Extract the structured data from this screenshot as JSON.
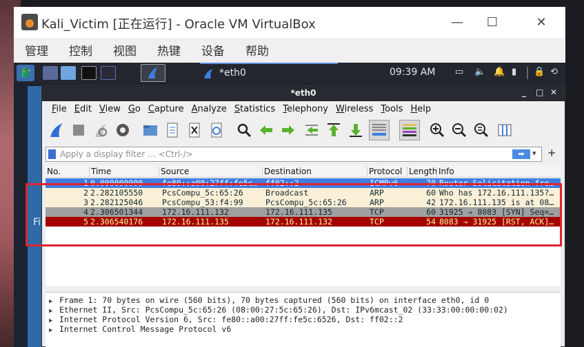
{
  "vbox": {
    "title": "Kali_Victim [正在运行] - Oracle VM VirtualBox",
    "minimize": "—",
    "maximize": "☐",
    "close": "✕",
    "menu": [
      "管理",
      "控制",
      "视图",
      "热键",
      "设备",
      "帮助"
    ]
  },
  "kali_panel": {
    "task_title": "*eth0",
    "clock": "09:39 AM"
  },
  "left_strip_text": "Fi",
  "wireshark": {
    "title": "*eth0",
    "win_min": "_",
    "win_max": "□",
    "win_close": "✕",
    "menu": [
      "File",
      "Edit",
      "View",
      "Go",
      "Capture",
      "Analyze",
      "Statistics",
      "Telephony",
      "Wireless",
      "Tools",
      "Help"
    ],
    "filter_placeholder": "Apply a display filter … <Ctrl-/>",
    "filter_plus": "+",
    "columns": [
      "No.",
      "Time",
      "Source",
      "Destination",
      "Protocol",
      "Length",
      "Info"
    ],
    "packets": [
      {
        "no": "1",
        "time": "0.000000000",
        "source": "fe80::a00:27ff:fe5c…",
        "destination": "ff02::2",
        "protocol": "ICMPv6",
        "length": "70",
        "info": "Router Solicitation fro…",
        "bg": "#3d7de0",
        "fg": "#ffffff"
      },
      {
        "no": "2",
        "time": "2.282105550",
        "source": "PcsCompu_5c:65:26",
        "destination": "Broadcast",
        "protocol": "ARP",
        "length": "60",
        "info": "Who has 172.16.111.135?…",
        "bg": "#faf0d7",
        "fg": "#12272e"
      },
      {
        "no": "3",
        "time": "2.282125046",
        "source": "PcsCompu_53:f4:99",
        "destination": "PcsCompu_5c:65:26",
        "protocol": "ARP",
        "length": "42",
        "info": "172.16.111.135 is at 08…",
        "bg": "#faf0d7",
        "fg": "#12272e"
      },
      {
        "no": "4",
        "time": "2.306501344",
        "source": "172.16.111.132",
        "destination": "172.16.111.135",
        "protocol": "TCP",
        "length": "60",
        "info": "31925 → 8083 [SYN] Seq=…",
        "bg": "#a0a0a0",
        "fg": "#12272e"
      },
      {
        "no": "5",
        "time": "2.306540176",
        "source": "172.16.111.135",
        "destination": "172.16.111.132",
        "protocol": "TCP",
        "length": "54",
        "info": "8083 → 31925 [RST, ACK]…",
        "bg": "#a40000",
        "fg": "#fffc9c"
      }
    ],
    "details": [
      "Frame 1: 70 bytes on wire (560 bits), 70 bytes captured (560 bits) on interface eth0, id 0",
      "Ethernet II, Src: PcsCompu_5c:65:26 (08:00:27:5c:65:26), Dst: IPv6mcast_02 (33:33:00:00:00:02)",
      "Internet Protocol Version 6, Src: fe80::a00:27ff:fe5c:6526, Dst: ff02::2",
      "Internet Control Message Protocol v6"
    ]
  },
  "colors": {
    "highlight": "#e0232e",
    "kali_panel": "#23262e",
    "wireshark_title": "#272a31"
  }
}
